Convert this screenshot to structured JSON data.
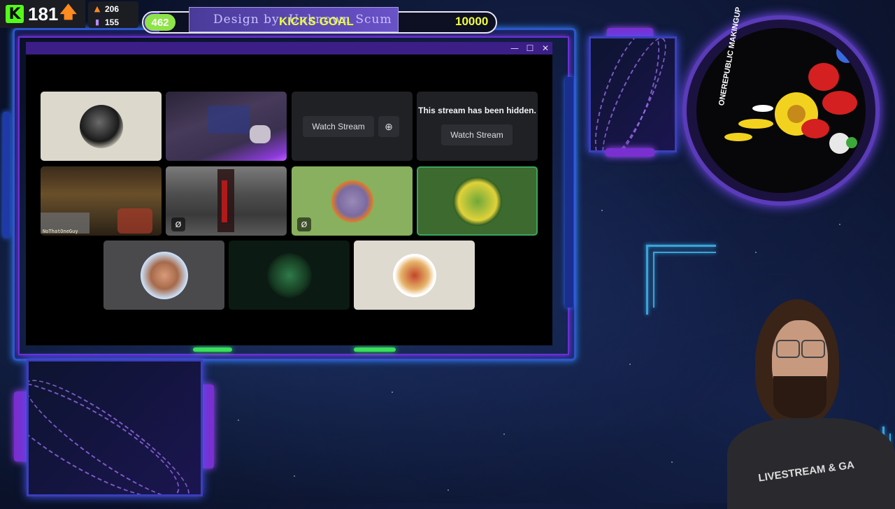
{
  "kick": {
    "count": "181",
    "arrow": "🡅",
    "logo": "K"
  },
  "stats": {
    "followers": "206",
    "subs": "155"
  },
  "goal": {
    "current": "462",
    "title": "KICKS GOAL",
    "target": "10000",
    "design_credit": "Design by: Unknown Scum",
    "progress": 0.0462
  },
  "window": {
    "minimize": "—",
    "maximize": "☐",
    "close": "✕"
  },
  "tiles": {
    "watch_stream": "Watch Stream",
    "hidden_message": "This stream has been hidden.",
    "hidden_watch": "Watch Stream",
    "game_caption": "NoThatOneGuy"
  },
  "logo": {
    "text": "ONEREPUBLIC MAKINGUP"
  },
  "webcam": {
    "shirt_text": "LIVESTREAM & GA"
  },
  "colors": {
    "accent": "#53fc18",
    "frame": "#2f56c9",
    "neon_purple": "#6b2fd8",
    "goal_yellow": "#e8ff3a"
  }
}
